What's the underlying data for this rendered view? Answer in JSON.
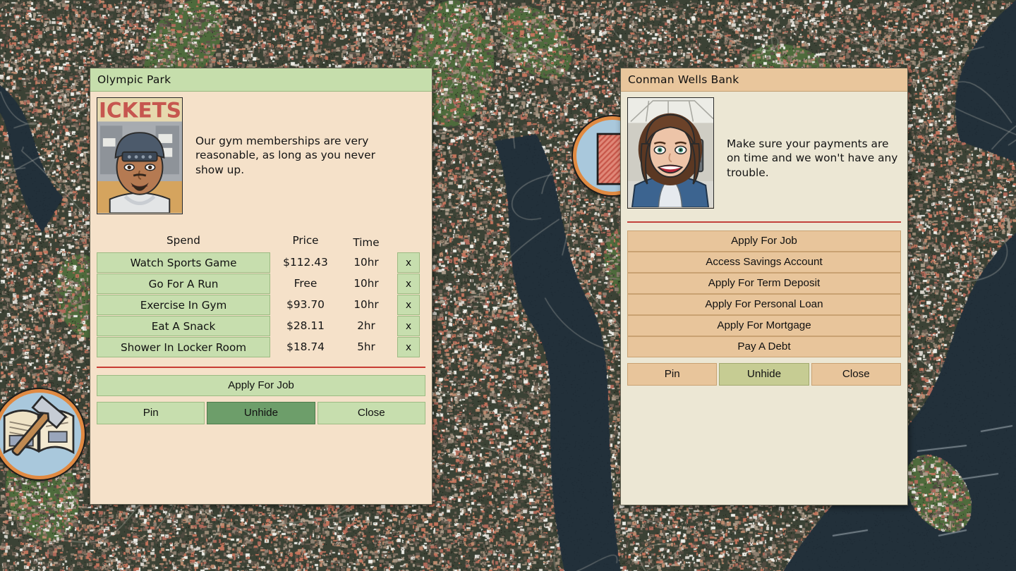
{
  "background": {
    "type": "satellite-map",
    "land_color": "#3b4235",
    "water_color": "#22303a",
    "urban_color": "#6b5f54",
    "roof_color": "#c4745c",
    "park_color": "#4e6b3c"
  },
  "map_icons": [
    {
      "name": "crafting-book-icon",
      "glyph": "hammer-and-book",
      "ring_color": "#e08a42",
      "fill_color": "#a9c8dc"
    },
    {
      "name": "building-icon",
      "glyph": "red-striped-building",
      "ring_color": "#e08a42",
      "fill_color": "#a9c8dc"
    }
  ],
  "panels": {
    "olympic_park": {
      "title": "Olympic Park",
      "accent": "#c6deac",
      "body_color": "#f5e1c9",
      "portrait_alt": "gym attendant at ticket booth",
      "dialogue": "Our gym memberships are very reasonable, as long as you never show up.",
      "table": {
        "headers": {
          "spend": "Spend",
          "price": "Price",
          "time": "Time"
        },
        "rows": [
          {
            "action": "Watch Sports Game",
            "price": "$112.43",
            "time": "10hr",
            "remove": "x"
          },
          {
            "action": "Go For A Run",
            "price": "Free",
            "time": "10hr",
            "remove": "x"
          },
          {
            "action": "Exercise In Gym",
            "price": "$93.70",
            "time": "10hr",
            "remove": "x"
          },
          {
            "action": "Eat A Snack",
            "price": "$28.11",
            "time": "2hr",
            "remove": "x"
          },
          {
            "action": "Shower In Locker Room",
            "price": "$18.74",
            "time": "5hr",
            "remove": "x"
          }
        ]
      },
      "primary_action": "Apply For Job",
      "footer": {
        "pin": "Pin",
        "unhide": "Unhide",
        "close": "Close",
        "active": "unhide"
      }
    },
    "conman_wells_bank": {
      "title": "Conman Wells Bank",
      "accent": "#e9c69c",
      "body_color": "#ece7d4",
      "portrait_alt": "bank teller in blue blazer",
      "dialogue": "Make sure your payments are on time and we won't have any trouble.",
      "menu": [
        "Apply For Job",
        "Access Savings Account",
        "Apply For Term Deposit",
        "Apply For Personal Loan",
        "Apply For Mortgage",
        "Pay A Debt"
      ],
      "footer": {
        "pin": "Pin",
        "unhide": "Unhide",
        "close": "Close",
        "active": "unhide"
      }
    }
  }
}
